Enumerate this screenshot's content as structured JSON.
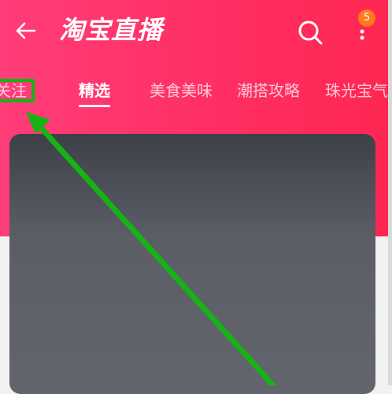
{
  "header": {
    "title": "淘宝直播",
    "notification_count": "5",
    "back_icon": "arrow-left-icon",
    "search_icon": "search-icon",
    "more_icon": "more-vertical-icon"
  },
  "tabs": [
    {
      "label": "关注"
    },
    {
      "label": "精选"
    },
    {
      "label": "美食美味"
    },
    {
      "label": "潮搭攻略"
    },
    {
      "label": "珠光宝气"
    }
  ],
  "colors": {
    "header_gradient_start": "#ff3d79",
    "header_gradient_end": "#ff2652",
    "annotation": "#16b314",
    "badge": "#ff7a1a"
  }
}
